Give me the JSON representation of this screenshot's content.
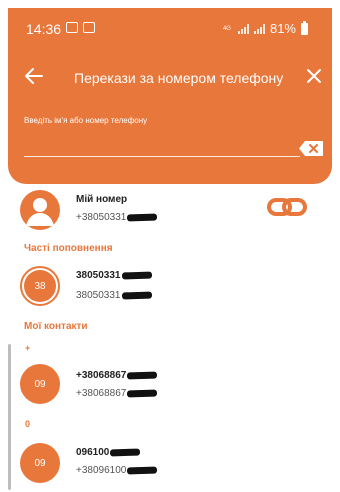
{
  "status_bar": {
    "time": "14:36",
    "network": "4G",
    "battery": "81%"
  },
  "toolbar": {
    "title": "Перекази за номером телефону",
    "back_icon": "arrow-left-icon",
    "close_icon": "close-icon"
  },
  "search": {
    "label": "Введіть ім'я або номер телефону",
    "value": "",
    "clear_icon": "backspace-icon"
  },
  "my_number": {
    "name": "Мій номер",
    "phone": "+38050331",
    "link_icon": "link-icon"
  },
  "frequent": {
    "title": "Часті поповнення",
    "items": [
      {
        "avatar": "38",
        "name": "38050331",
        "phone": "38050331"
      }
    ]
  },
  "contacts": {
    "title": "Мої контакти",
    "groups": [
      {
        "letter": "+",
        "items": [
          {
            "avatar": "09",
            "name": "+38068867",
            "phone": "+38068867"
          }
        ]
      },
      {
        "letter": "0",
        "items": [
          {
            "avatar": "09",
            "name": "096100",
            "phone": "+38096100"
          }
        ]
      }
    ]
  },
  "colors": {
    "accent": "#e8773b",
    "text": "#222222",
    "muted": "#555555"
  }
}
